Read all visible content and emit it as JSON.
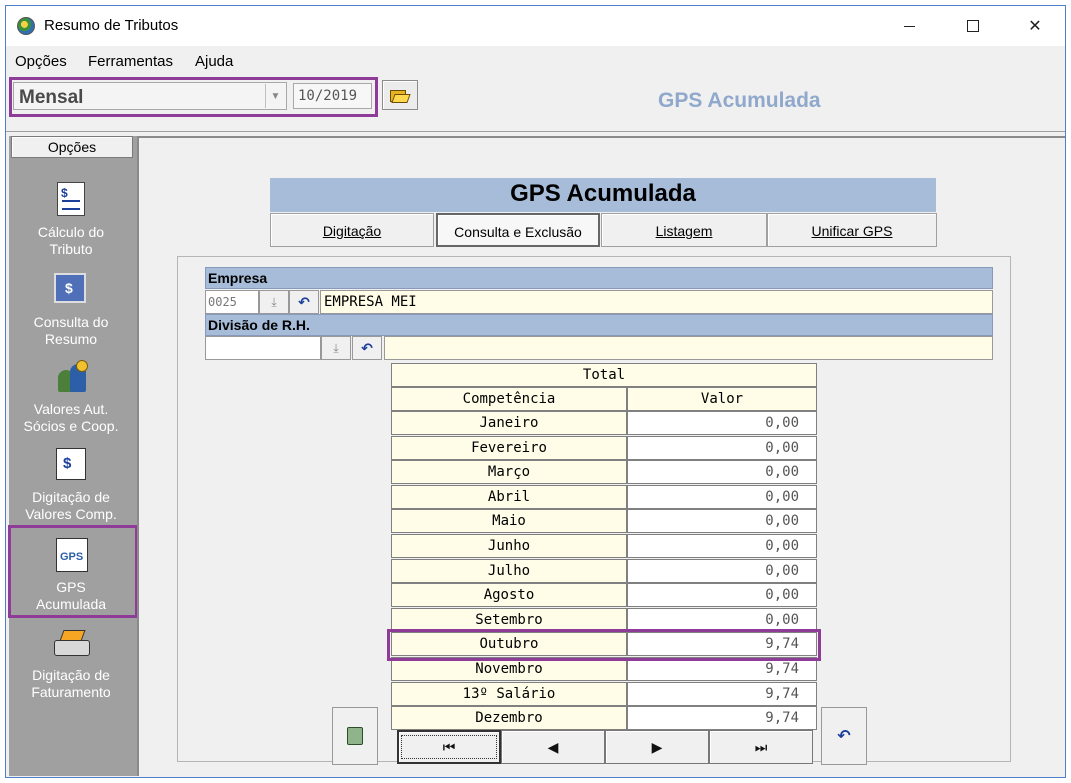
{
  "window": {
    "title": "Resumo de Tributos",
    "controls": {
      "minimize_icon": "minimize-icon",
      "maximize_icon": "maximize-icon",
      "close_icon": "close-icon"
    }
  },
  "menu": {
    "items": [
      "Opções",
      "Ferramentas",
      "Ajuda"
    ]
  },
  "toolbar": {
    "period_type": "Mensal",
    "month": "10/2019",
    "open_icon": "folder-open-icon",
    "heading": "GPS Acumulada"
  },
  "sidebar": {
    "header": "Opções",
    "items": [
      {
        "line1": "Cálculo do",
        "line2": "Tributo",
        "icon": "tax-calc-icon"
      },
      {
        "line1": "Consulta do",
        "line2": "Resumo",
        "icon": "summary-screen-icon"
      },
      {
        "line1": "Valores Aut.",
        "line2": "Sócios e  Coop.",
        "icon": "partners-icon"
      },
      {
        "line1": "Digitação de",
        "line2": "Valores Comp.",
        "icon": "edit-values-icon"
      },
      {
        "line1": "GPS",
        "line2": "Acumulada",
        "icon": "gps-icon"
      },
      {
        "line1": "Digitação de",
        "line2": "Faturamento",
        "icon": "printer-icon"
      }
    ],
    "active_index": 4
  },
  "form": {
    "title": "GPS Acumulada",
    "tabs": [
      {
        "label": "Digitação",
        "active": false
      },
      {
        "label": "Consulta e Exclusão",
        "active": true
      },
      {
        "label": "Listagem",
        "active": false
      },
      {
        "label": "Unificar GPS",
        "active": false
      }
    ],
    "empresa": {
      "label": "Empresa",
      "code": "0025",
      "name": "EMPRESA MEI"
    },
    "divisao": {
      "label": "Divisão de R.H.",
      "code": "",
      "name": ""
    }
  },
  "grid": {
    "header_total": "Total",
    "col_month": "Competência",
    "col_value": "Valor",
    "rows": [
      {
        "month": "Janeiro",
        "value": "0,00"
      },
      {
        "month": "Fevereiro",
        "value": "0,00"
      },
      {
        "month": "Março",
        "value": "0,00"
      },
      {
        "month": "Abril",
        "value": "0,00"
      },
      {
        "month": "Maio",
        "value": "0,00"
      },
      {
        "month": "Junho",
        "value": "0,00"
      },
      {
        "month": "Julho",
        "value": "0,00"
      },
      {
        "month": "Agosto",
        "value": "0,00"
      },
      {
        "month": "Setembro",
        "value": "0,00"
      },
      {
        "month": "Outubro",
        "value": "9,74"
      },
      {
        "month": "Novembro",
        "value": "9,74"
      },
      {
        "month": "13º Salário",
        "value": "9,74"
      },
      {
        "month": "Dezembro",
        "value": "9,74"
      }
    ],
    "highlighted_month": "Outubro"
  },
  "navigator": {
    "first": "⏮",
    "prev": "◀",
    "next": "▶",
    "last": "⏭"
  },
  "colors": {
    "accent_highlight": "#8e3c97",
    "header_blue": "#a6bcd8",
    "cell_yellow": "#fffde8",
    "heading_text": "#8fa8cc"
  }
}
